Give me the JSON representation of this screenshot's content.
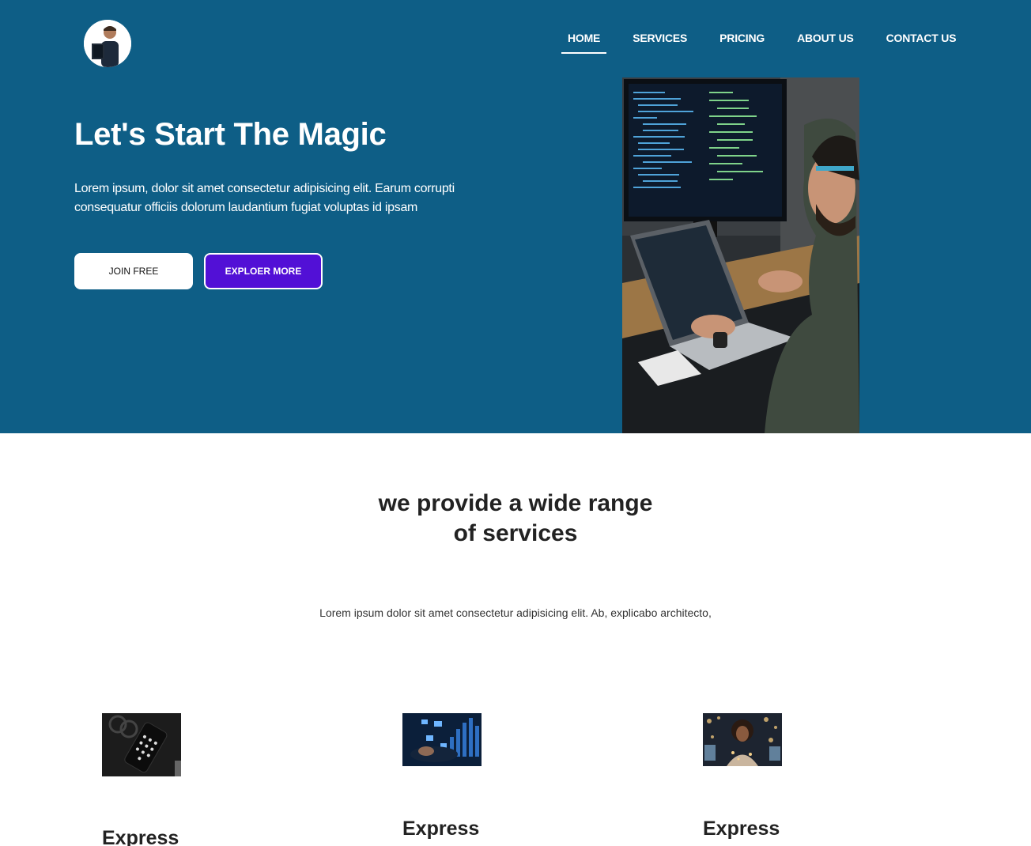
{
  "nav": {
    "items": [
      {
        "label": "HOME",
        "active": true
      },
      {
        "label": "SERVICES",
        "active": false
      },
      {
        "label": "PRICING",
        "active": false
      },
      {
        "label": "ABOUT US",
        "active": false
      },
      {
        "label": "CONTACT US",
        "active": false
      }
    ]
  },
  "hero": {
    "title": "Let's Start The Magic",
    "text": "Lorem ipsum, dolor sit amet consectetur adipisicing elit. Earum corrupti consequatur officiis dolorum laudantium fugiat voluptas id ipsam",
    "join_label": "JOIN FREE",
    "explore_label": "EXPLOER MORE"
  },
  "services": {
    "title_line1": "we provide a wide range",
    "title_line2": "of services",
    "subtitle": "Lorem ipsum dolor sit amet consectetur adipisicing elit. Ab, explicabo architecto,",
    "cards": [
      {
        "title": "Express"
      },
      {
        "title": "Express"
      },
      {
        "title": "Express"
      }
    ]
  },
  "colors": {
    "hero_bg": "#0e5e86",
    "accent_button": "#5210d6"
  }
}
